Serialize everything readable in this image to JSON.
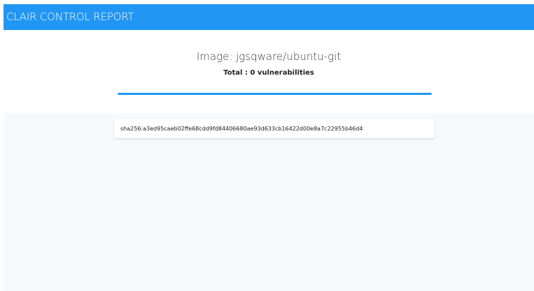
{
  "appbar": {
    "title": "CLAIR CONTROL REPORT"
  },
  "report": {
    "image_title": "Image: jgsqware/ubuntu-git",
    "total": "Total : 0 vulnerabilities",
    "progress": 1.0
  },
  "layers": [
    {
      "hash": "sha256:a3ed95caeb02ffe68cdd9fd84406680ae93d633cb16422d00e8a7c22955b46d4"
    }
  ],
  "colors": {
    "primary": "#2196f3",
    "background": "#f7f8fc",
    "card": "#ffffff",
    "text": "#222222"
  }
}
